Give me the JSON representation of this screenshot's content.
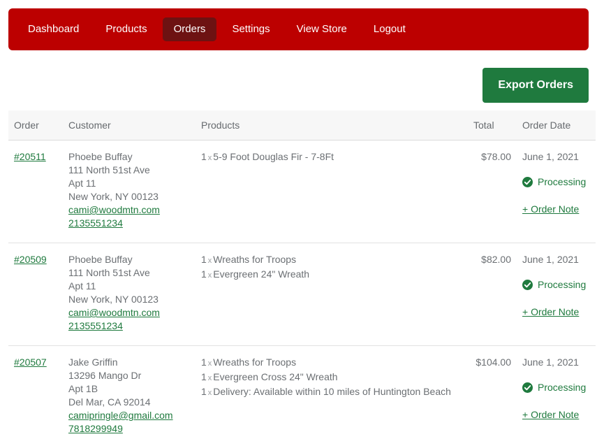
{
  "nav": {
    "items": [
      {
        "label": "Dashboard",
        "active": false
      },
      {
        "label": "Products",
        "active": false
      },
      {
        "label": "Orders",
        "active": true
      },
      {
        "label": "Settings",
        "active": false
      },
      {
        "label": "View Store",
        "active": false
      },
      {
        "label": "Logout",
        "active": false
      }
    ]
  },
  "toolbar": {
    "export_label": "Export Orders"
  },
  "colors": {
    "nav_background": "#bc0000",
    "nav_active": "#6d1212",
    "accent_green": "#1f7a3e",
    "text_muted": "#6b6f73",
    "header_background": "#f7f7f7"
  },
  "table": {
    "headers": {
      "order": "Order",
      "customer": "Customer",
      "products": "Products",
      "total": "Total",
      "date": "Order Date"
    },
    "note_label": "+ Order Note",
    "rows": [
      {
        "order_id": "#20511",
        "customer": {
          "name": "Phoebe Buffay",
          "address1": "111 North 51st Ave",
          "address2": "Apt 11",
          "city_state_zip": "New York, NY 00123",
          "email": "cami@woodmtn.com",
          "phone": "2135551234"
        },
        "products": [
          {
            "qty": "1",
            "sep": "x",
            "name": "5-9 Foot Douglas Fir - 7-8Ft"
          }
        ],
        "total": "$78.00",
        "date": "June 1, 2021",
        "status": "Processing"
      },
      {
        "order_id": "#20509",
        "customer": {
          "name": "Phoebe Buffay",
          "address1": "111 North 51st Ave",
          "address2": "Apt 11",
          "city_state_zip": "New York, NY 00123",
          "email": "cami@woodmtn.com",
          "phone": "2135551234"
        },
        "products": [
          {
            "qty": "1",
            "sep": "x",
            "name": "Wreaths for Troops"
          },
          {
            "qty": "1",
            "sep": "x",
            "name": "Evergreen 24\" Wreath"
          }
        ],
        "total": "$82.00",
        "date": "June 1, 2021",
        "status": "Processing"
      },
      {
        "order_id": "#20507",
        "customer": {
          "name": "Jake Griffin",
          "address1": "13296 Mango Dr",
          "address2": "Apt 1B",
          "city_state_zip": "Del Mar, CA 92014",
          "email": "camipringle@gmail.com",
          "phone": "7818299949"
        },
        "products": [
          {
            "qty": "1",
            "sep": "x",
            "name": "Wreaths for Troops"
          },
          {
            "qty": "1",
            "sep": "x",
            "name": "Evergreen Cross 24\" Wreath"
          },
          {
            "qty": "1",
            "sep": "x",
            "name": "Delivery: Available within 10 miles of Huntington Beach"
          }
        ],
        "total": "$104.00",
        "date": "June 1, 2021",
        "status": "Processing"
      }
    ]
  }
}
